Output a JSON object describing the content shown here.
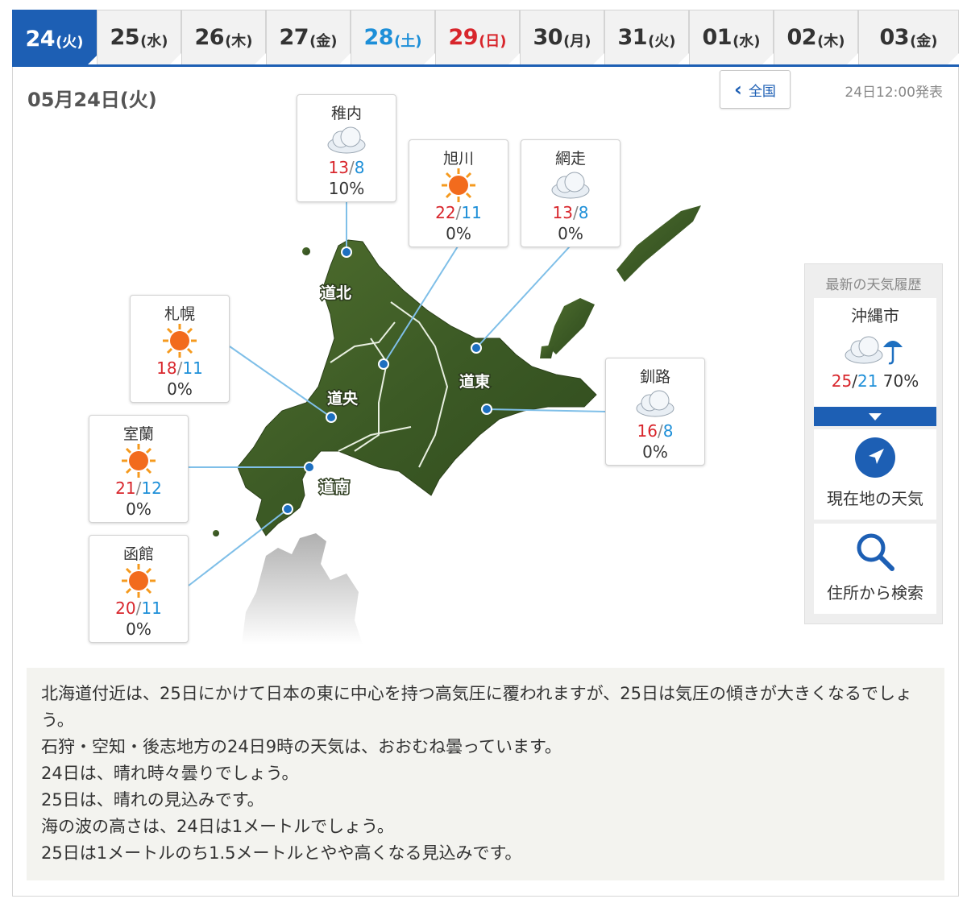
{
  "tabs": [
    {
      "day": "24",
      "dow": "(火)",
      "kind": "active"
    },
    {
      "day": "25",
      "dow": "(水)",
      "kind": ""
    },
    {
      "day": "26",
      "dow": "(木)",
      "kind": ""
    },
    {
      "day": "27",
      "dow": "(金)",
      "kind": ""
    },
    {
      "day": "28",
      "dow": "(土)",
      "kind": "sat"
    },
    {
      "day": "29",
      "dow": "(日)",
      "kind": "sun"
    },
    {
      "day": "30",
      "dow": "(月)",
      "kind": ""
    },
    {
      "day": "31",
      "dow": "(火)",
      "kind": ""
    },
    {
      "day": "01",
      "dow": "(水)",
      "kind": ""
    },
    {
      "day": "02",
      "dow": "(木)",
      "kind": ""
    },
    {
      "day": "03",
      "dow": "(金)",
      "kind": ""
    }
  ],
  "header": {
    "date": "05月24日(火)",
    "all_label": "全国",
    "published": "24日12:00発表"
  },
  "regions": {
    "north": "道北",
    "central": "道央",
    "east": "道東",
    "south": "道南"
  },
  "cities": [
    {
      "id": "wakkanai",
      "name": "稚内",
      "weather": "cloudy",
      "high": "13",
      "low": "8",
      "pop": "10%"
    },
    {
      "id": "asahikawa",
      "name": "旭川",
      "weather": "sunny",
      "high": "22",
      "low": "11",
      "pop": "0%"
    },
    {
      "id": "abashiri",
      "name": "網走",
      "weather": "cloudy",
      "high": "13",
      "low": "8",
      "pop": "0%"
    },
    {
      "id": "sapporo",
      "name": "札幌",
      "weather": "sunny",
      "high": "18",
      "low": "11",
      "pop": "0%"
    },
    {
      "id": "kushiro",
      "name": "釧路",
      "weather": "cloudy",
      "high": "16",
      "low": "8",
      "pop": "0%"
    },
    {
      "id": "muroran",
      "name": "室蘭",
      "weather": "sunny",
      "high": "21",
      "low": "12",
      "pop": "0%"
    },
    {
      "id": "hakodate",
      "name": "函館",
      "weather": "sunny",
      "high": "20",
      "low": "11",
      "pop": "0%"
    }
  ],
  "side": {
    "title": "最新の天気履歴",
    "city": "沖縄市",
    "weather": "cloudy-rain",
    "high": "25",
    "low": "21",
    "pop": "70%",
    "location_label": "現在地の天気",
    "search_label": "住所から検索"
  },
  "forecast_text": [
    "北海道付近は、25日にかけて日本の東に中心を持つ高気圧に覆われますが、25日は気圧の傾きが大きくなるでしょう。",
    "石狩・空知・後志地方の24日9時の天気は、おおむね曇っています。",
    "24日は、晴れ時々曇りでしょう。",
    "25日は、晴れの見込みです。",
    "海の波の高さは、24日は1メートルでしょう。",
    "25日は1メートルのち1.5メートルとやや高くなる見込みです。"
  ],
  "colors": {
    "accent": "#1d5fb4",
    "high": "#d8262c",
    "low": "#1d8fd8",
    "saturday": "#1d8fd8",
    "sunday": "#d8262c"
  }
}
